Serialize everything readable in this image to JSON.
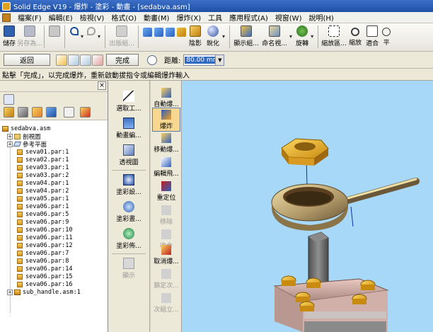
{
  "window": {
    "title": "Solid Edge V19 - 爆炸 - 塗彩 - 動畫 - [sedabva.asm]"
  },
  "menu": [
    "檔案(F)",
    "編輯(E)",
    "檢視(V)",
    "格式(O)",
    "動畫(M)",
    "爆炸(X)",
    "工具",
    "應用程式(A)",
    "視窗(W)",
    "說明(H)"
  ],
  "toolbar": {
    "save": "儲存",
    "save_as": "另存為...",
    "publish": "出版組...",
    "shading": "陰影",
    "sharpen": "銳化",
    "display": "顯示組...",
    "name": "命名視...",
    "rotate": "旋轉",
    "zoom_area": "縮放區...",
    "zoom": "縮放",
    "fit": "適合",
    "pan": "平"
  },
  "cmdbar": {
    "back": "返回",
    "done": "完成",
    "distance_label": "距離:",
    "distance_value": "80.00 mm"
  },
  "prompt": "點擊「完成」，以完成爆炸，重新啟動拔指令或編輯爆炸輸入",
  "tree": {
    "root": "sedabva.asm",
    "items": [
      {
        "label": "剖視圖",
        "kind": "folder"
      },
      {
        "label": "參考平面",
        "kind": "plane"
      },
      {
        "label": "seva01.par:1",
        "kind": "part"
      },
      {
        "label": "seva02.par:1",
        "kind": "part"
      },
      {
        "label": "seva03.par:1",
        "kind": "part"
      },
      {
        "label": "seva03.par:2",
        "kind": "part"
      },
      {
        "label": "seva04.par:1",
        "kind": "part"
      },
      {
        "label": "seva04.par:2",
        "kind": "part"
      },
      {
        "label": "seva05.par:1",
        "kind": "part"
      },
      {
        "label": "seva06.par:1",
        "kind": "part"
      },
      {
        "label": "seva06.par:5",
        "kind": "part"
      },
      {
        "label": "seva06.par:9",
        "kind": "part"
      },
      {
        "label": "seva06.par:10",
        "kind": "part"
      },
      {
        "label": "seva06.par:11",
        "kind": "part"
      },
      {
        "label": "seva06.par:12",
        "kind": "part"
      },
      {
        "label": "seva06.par:7",
        "kind": "part"
      },
      {
        "label": "seva06.par:8",
        "kind": "part"
      },
      {
        "label": "seva06.par:14",
        "kind": "part"
      },
      {
        "label": "seva06.par:15",
        "kind": "part"
      },
      {
        "label": "seva06.par:16",
        "kind": "part"
      },
      {
        "label": "sub_handle.asm:1",
        "kind": "asm"
      }
    ]
  },
  "tools1": [
    {
      "label": "選取工..."
    },
    {
      "label": "動畫編..."
    },
    {
      "label": "透視圖"
    },
    {
      "label": "塗彩設..."
    },
    {
      "label": "塗彩晝..."
    },
    {
      "label": "塗彩佈..."
    },
    {
      "label": "顯示"
    }
  ],
  "tools2": [
    {
      "label": "自動爆..."
    },
    {
      "label": "爆炸"
    },
    {
      "label": "移動爆..."
    },
    {
      "label": "編輯飛..."
    },
    {
      "label": "重定位"
    },
    {
      "label": "移除"
    },
    {
      "label": "收合"
    },
    {
      "label": "取消爆..."
    },
    {
      "label": "鎖定次..."
    },
    {
      "label": "次組立..."
    }
  ]
}
